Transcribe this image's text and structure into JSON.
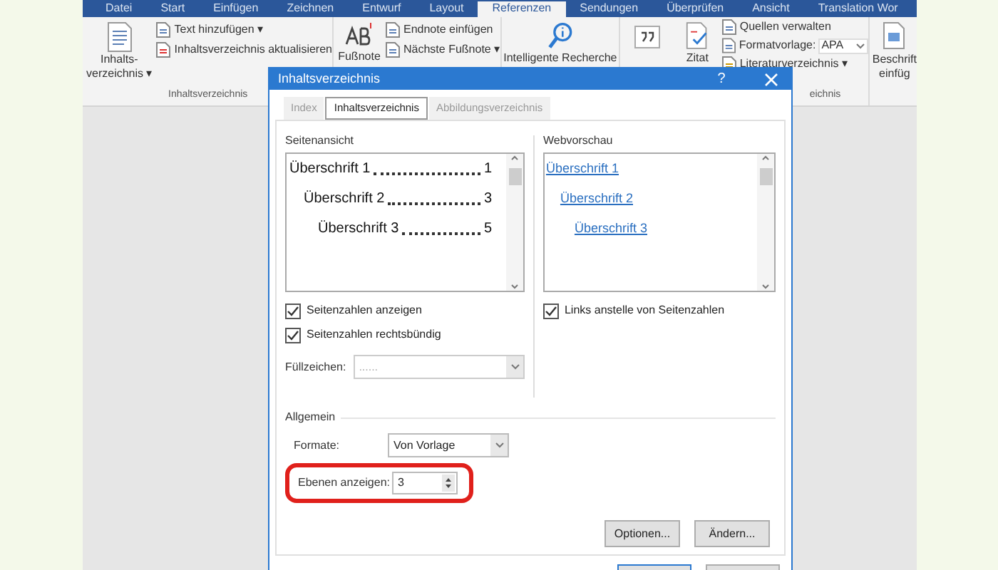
{
  "ribbon_tabs": [
    {
      "label": "Datei",
      "selected": false
    },
    {
      "label": "Start",
      "selected": false
    },
    {
      "label": "Einfügen",
      "selected": false
    },
    {
      "label": "Zeichnen",
      "selected": false
    },
    {
      "label": "Entwurf",
      "selected": false
    },
    {
      "label": "Layout",
      "selected": false
    },
    {
      "label": "Referenzen",
      "selected": true
    },
    {
      "label": "Sendungen",
      "selected": false
    },
    {
      "label": "Überprüfen",
      "selected": false
    },
    {
      "label": "Ansicht",
      "selected": false
    },
    {
      "label": "Translation Wor",
      "selected": false
    }
  ],
  "ribbon": {
    "toc_group": {
      "big_button": "Inhalts-\nverzeichnis ▾",
      "items": [
        "Text hinzufügen ▾",
        "Inhaltsverzeichnis aktualisieren"
      ],
      "label": "Inhaltsverzeichnis"
    },
    "footnote_group": {
      "big_button": "Fußnote",
      "items": [
        "Endnote einfügen",
        "Nächste Fußnote ▾"
      ]
    },
    "research_button": "Intelligente Recherche",
    "citation_button": "Zitat",
    "citation_items": [
      "Quellen verwalten",
      "Literaturverzeichnis ▾"
    ],
    "style_label": "Formatvorlage:",
    "style_value": "APA",
    "citation_group_label": "eichnis",
    "caption_button": "Beschrift\neinfüg"
  },
  "dialog": {
    "title": "Inhaltsverzeichnis",
    "help": "?",
    "tabs": [
      {
        "label": "Index",
        "selected": false
      },
      {
        "label": "Inhaltsverzeichnis",
        "selected": true
      },
      {
        "label": "Abbildungsverzeichnis",
        "selected": false
      }
    ],
    "print_preview": {
      "label": "Seitenansicht",
      "entries": [
        {
          "title": "Überschrift 1",
          "page": "1",
          "children": [
            {
              "title": "Überschrift 2",
              "page": "3",
              "children": [
                {
                  "title": "Überschrift 3",
                  "page": "5"
                }
              ]
            }
          ]
        }
      ]
    },
    "web_preview": {
      "label": "Webvorschau",
      "entries": [
        {
          "title": "Überschrift 1",
          "children": [
            {
              "title": "Überschrift 2",
              "children": [
                {
                  "title": "Überschrift 3"
                }
              ]
            }
          ]
        }
      ]
    },
    "left_options": [
      {
        "label": "Seitenzahlen anzeigen",
        "checked": true
      },
      {
        "label": "Seitenzahlen rechtsbündig",
        "checked": true
      }
    ],
    "right_options": [
      {
        "label": "Links anstelle von Seitenzahlen",
        "checked": true
      }
    ],
    "fill": {
      "label": "Füllzeichen:",
      "value": "......",
      "disabled": true
    },
    "general": {
      "label": "Allgemein",
      "formats_label": "Formate:",
      "formats_value": "Von Vorlage",
      "levels_label": "Ebenen anzeigen:",
      "levels_value": "3",
      "levels_highlighted": true
    },
    "buttons": [
      "Optionen...",
      "Ändern..."
    ]
  }
}
